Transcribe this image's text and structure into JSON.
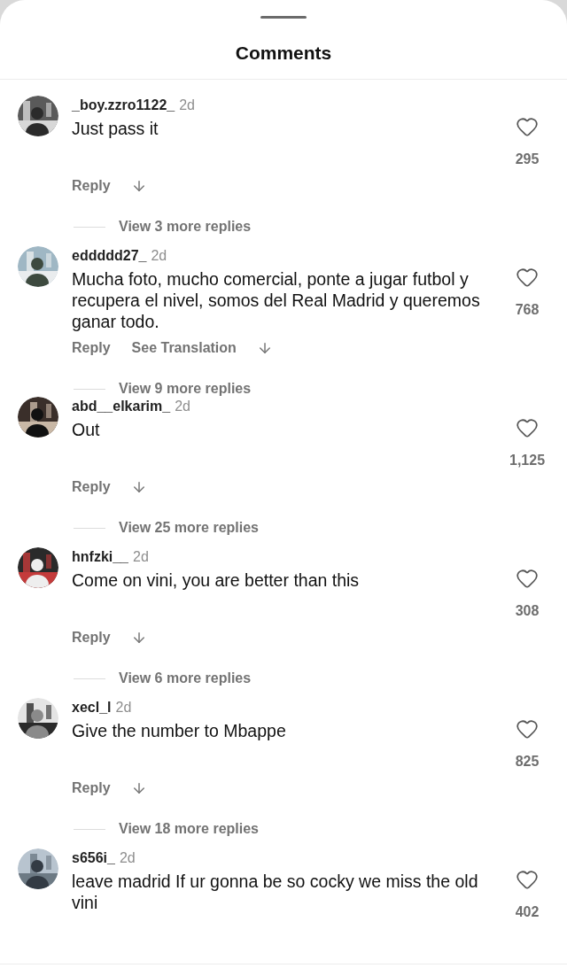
{
  "title": "Comments",
  "comments": [
    {
      "username": "_boy.zzro1122_",
      "time": "2d",
      "text": "Just pass it",
      "likes": "295",
      "actions": [
        "Reply"
      ],
      "view_replies": "View 3 more replies"
    },
    {
      "username": "eddddd27_",
      "time": "2d",
      "text": "Mucha foto, mucho comercial, ponte a jugar futbol y recupera el nivel, somos del Real Madrid y queremos ganar todo.",
      "likes": "768",
      "actions": [
        "Reply",
        "See Translation"
      ],
      "view_replies": "View 9 more replies"
    },
    {
      "username": "abd__elkarim_",
      "time": "2d",
      "text": "Out",
      "likes": "1,125",
      "actions": [
        "Reply"
      ],
      "view_replies": "View 25 more replies"
    },
    {
      "username": "hnfzki__",
      "time": "2d",
      "text": "Come on vini, you are better than this",
      "likes": "308",
      "actions": [
        "Reply"
      ],
      "view_replies": "View 6 more replies"
    },
    {
      "username": "xecl_l",
      "time": "2d",
      "text": "Give the number to Mbappe",
      "likes": "825",
      "actions": [
        "Reply"
      ],
      "view_replies": "View 18 more replies"
    },
    {
      "username": "s656i_",
      "time": "2d",
      "text": "leave madrid If ur gonna be so cocky we miss the old vini",
      "likes": "402"
    }
  ]
}
